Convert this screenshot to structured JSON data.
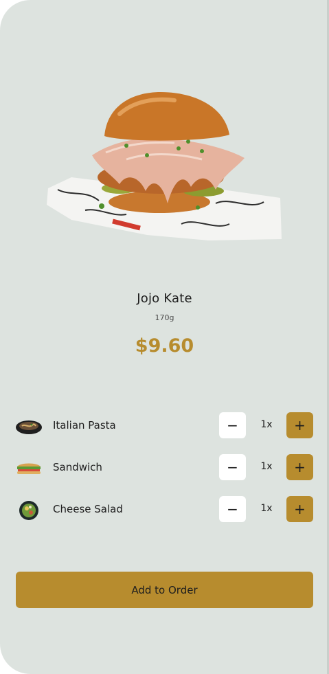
{
  "dish": {
    "name": "Jojo Kate",
    "weight": "170g",
    "price": "$9.60"
  },
  "addons": [
    {
      "name": "Italian Pasta",
      "quantity": "1x",
      "minus": "−",
      "plus": "+"
    },
    {
      "name": "Sandwich",
      "quantity": "1x",
      "minus": "−",
      "plus": "+"
    },
    {
      "name": "Cheese Salad",
      "quantity": "1x",
      "minus": "−",
      "plus": "+"
    }
  ],
  "actions": {
    "add_to_order": "Add to Order"
  },
  "colors": {
    "background": "#dde3df",
    "accent": "#b78c2e",
    "text": "#1e1e1e"
  }
}
